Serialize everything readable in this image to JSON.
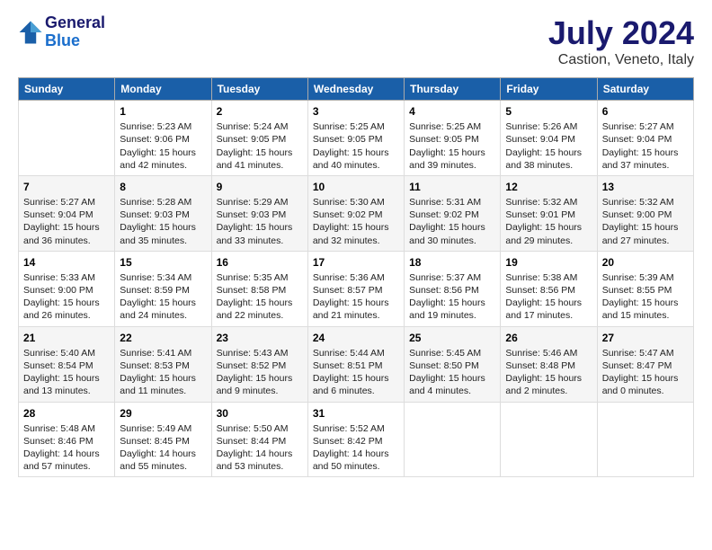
{
  "header": {
    "logo_line1": "General",
    "logo_line2": "Blue",
    "title": "July 2024",
    "subtitle": "Castion, Veneto, Italy"
  },
  "days_of_week": [
    "Sunday",
    "Monday",
    "Tuesday",
    "Wednesday",
    "Thursday",
    "Friday",
    "Saturday"
  ],
  "weeks": [
    [
      {
        "day": "",
        "content": ""
      },
      {
        "day": "1",
        "content": "Sunrise: 5:23 AM\nSunset: 9:06 PM\nDaylight: 15 hours\nand 42 minutes."
      },
      {
        "day": "2",
        "content": "Sunrise: 5:24 AM\nSunset: 9:05 PM\nDaylight: 15 hours\nand 41 minutes."
      },
      {
        "day": "3",
        "content": "Sunrise: 5:25 AM\nSunset: 9:05 PM\nDaylight: 15 hours\nand 40 minutes."
      },
      {
        "day": "4",
        "content": "Sunrise: 5:25 AM\nSunset: 9:05 PM\nDaylight: 15 hours\nand 39 minutes."
      },
      {
        "day": "5",
        "content": "Sunrise: 5:26 AM\nSunset: 9:04 PM\nDaylight: 15 hours\nand 38 minutes."
      },
      {
        "day": "6",
        "content": "Sunrise: 5:27 AM\nSunset: 9:04 PM\nDaylight: 15 hours\nand 37 minutes."
      }
    ],
    [
      {
        "day": "7",
        "content": "Sunrise: 5:27 AM\nSunset: 9:04 PM\nDaylight: 15 hours\nand 36 minutes."
      },
      {
        "day": "8",
        "content": "Sunrise: 5:28 AM\nSunset: 9:03 PM\nDaylight: 15 hours\nand 35 minutes."
      },
      {
        "day": "9",
        "content": "Sunrise: 5:29 AM\nSunset: 9:03 PM\nDaylight: 15 hours\nand 33 minutes."
      },
      {
        "day": "10",
        "content": "Sunrise: 5:30 AM\nSunset: 9:02 PM\nDaylight: 15 hours\nand 32 minutes."
      },
      {
        "day": "11",
        "content": "Sunrise: 5:31 AM\nSunset: 9:02 PM\nDaylight: 15 hours\nand 30 minutes."
      },
      {
        "day": "12",
        "content": "Sunrise: 5:32 AM\nSunset: 9:01 PM\nDaylight: 15 hours\nand 29 minutes."
      },
      {
        "day": "13",
        "content": "Sunrise: 5:32 AM\nSunset: 9:00 PM\nDaylight: 15 hours\nand 27 minutes."
      }
    ],
    [
      {
        "day": "14",
        "content": "Sunrise: 5:33 AM\nSunset: 9:00 PM\nDaylight: 15 hours\nand 26 minutes."
      },
      {
        "day": "15",
        "content": "Sunrise: 5:34 AM\nSunset: 8:59 PM\nDaylight: 15 hours\nand 24 minutes."
      },
      {
        "day": "16",
        "content": "Sunrise: 5:35 AM\nSunset: 8:58 PM\nDaylight: 15 hours\nand 22 minutes."
      },
      {
        "day": "17",
        "content": "Sunrise: 5:36 AM\nSunset: 8:57 PM\nDaylight: 15 hours\nand 21 minutes."
      },
      {
        "day": "18",
        "content": "Sunrise: 5:37 AM\nSunset: 8:56 PM\nDaylight: 15 hours\nand 19 minutes."
      },
      {
        "day": "19",
        "content": "Sunrise: 5:38 AM\nSunset: 8:56 PM\nDaylight: 15 hours\nand 17 minutes."
      },
      {
        "day": "20",
        "content": "Sunrise: 5:39 AM\nSunset: 8:55 PM\nDaylight: 15 hours\nand 15 minutes."
      }
    ],
    [
      {
        "day": "21",
        "content": "Sunrise: 5:40 AM\nSunset: 8:54 PM\nDaylight: 15 hours\nand 13 minutes."
      },
      {
        "day": "22",
        "content": "Sunrise: 5:41 AM\nSunset: 8:53 PM\nDaylight: 15 hours\nand 11 minutes."
      },
      {
        "day": "23",
        "content": "Sunrise: 5:43 AM\nSunset: 8:52 PM\nDaylight: 15 hours\nand 9 minutes."
      },
      {
        "day": "24",
        "content": "Sunrise: 5:44 AM\nSunset: 8:51 PM\nDaylight: 15 hours\nand 6 minutes."
      },
      {
        "day": "25",
        "content": "Sunrise: 5:45 AM\nSunset: 8:50 PM\nDaylight: 15 hours\nand 4 minutes."
      },
      {
        "day": "26",
        "content": "Sunrise: 5:46 AM\nSunset: 8:48 PM\nDaylight: 15 hours\nand 2 minutes."
      },
      {
        "day": "27",
        "content": "Sunrise: 5:47 AM\nSunset: 8:47 PM\nDaylight: 15 hours\nand 0 minutes."
      }
    ],
    [
      {
        "day": "28",
        "content": "Sunrise: 5:48 AM\nSunset: 8:46 PM\nDaylight: 14 hours\nand 57 minutes."
      },
      {
        "day": "29",
        "content": "Sunrise: 5:49 AM\nSunset: 8:45 PM\nDaylight: 14 hours\nand 55 minutes."
      },
      {
        "day": "30",
        "content": "Sunrise: 5:50 AM\nSunset: 8:44 PM\nDaylight: 14 hours\nand 53 minutes."
      },
      {
        "day": "31",
        "content": "Sunrise: 5:52 AM\nSunset: 8:42 PM\nDaylight: 14 hours\nand 50 minutes."
      },
      {
        "day": "",
        "content": ""
      },
      {
        "day": "",
        "content": ""
      },
      {
        "day": "",
        "content": ""
      }
    ]
  ]
}
